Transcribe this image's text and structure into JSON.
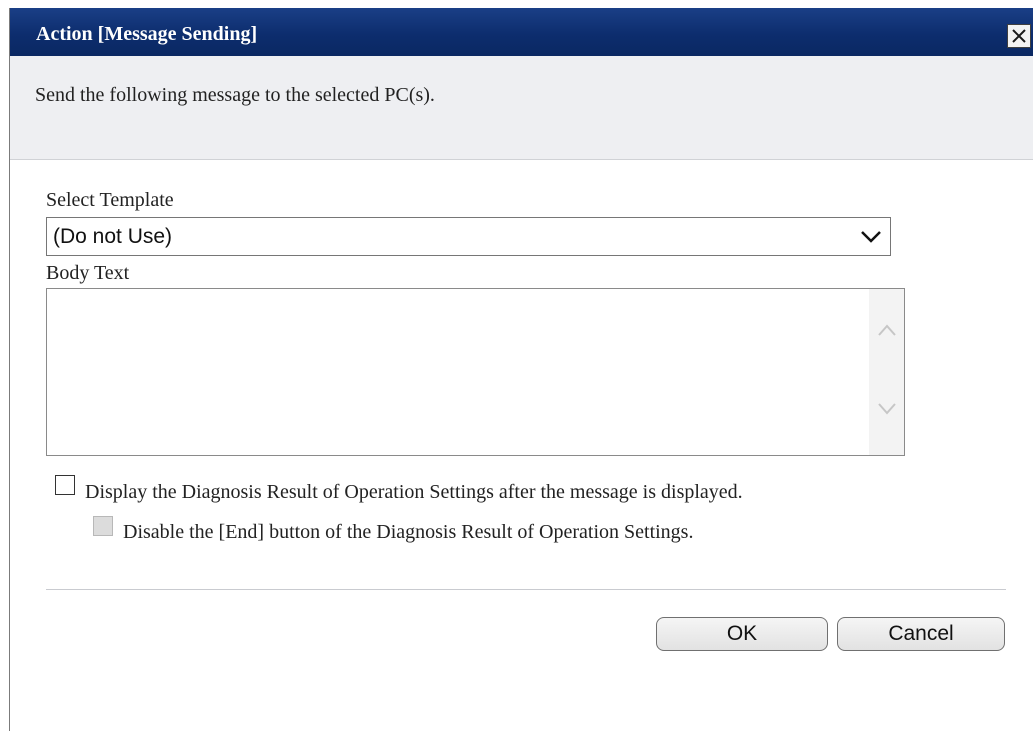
{
  "dialog": {
    "title": "Action [Message Sending]",
    "close_icon": "close-x-icon",
    "description": "Send the following message to the selected PC(s).",
    "template": {
      "label": "Select Template",
      "selected_value": "(Do not Use)",
      "icon": "chevron-down-icon"
    },
    "body": {
      "label": "Body Text",
      "value": "",
      "scroll_up_icon": "chevron-up-icon",
      "scroll_down_icon": "chevron-down-icon"
    },
    "options": {
      "display_diagnosis_label": "Display the Diagnosis Result of Operation Settings after the message is displayed.",
      "display_diagnosis_checked": false,
      "disable_end_label": "Disable the [End] button of the Diagnosis Result of Operation Settings.",
      "disable_end_checked": false,
      "disable_end_enabled": false
    },
    "buttons": {
      "ok": "OK",
      "cancel": "Cancel"
    }
  },
  "colors": {
    "titlebar": "#0d2d6e",
    "banner": "#eeeff2"
  }
}
